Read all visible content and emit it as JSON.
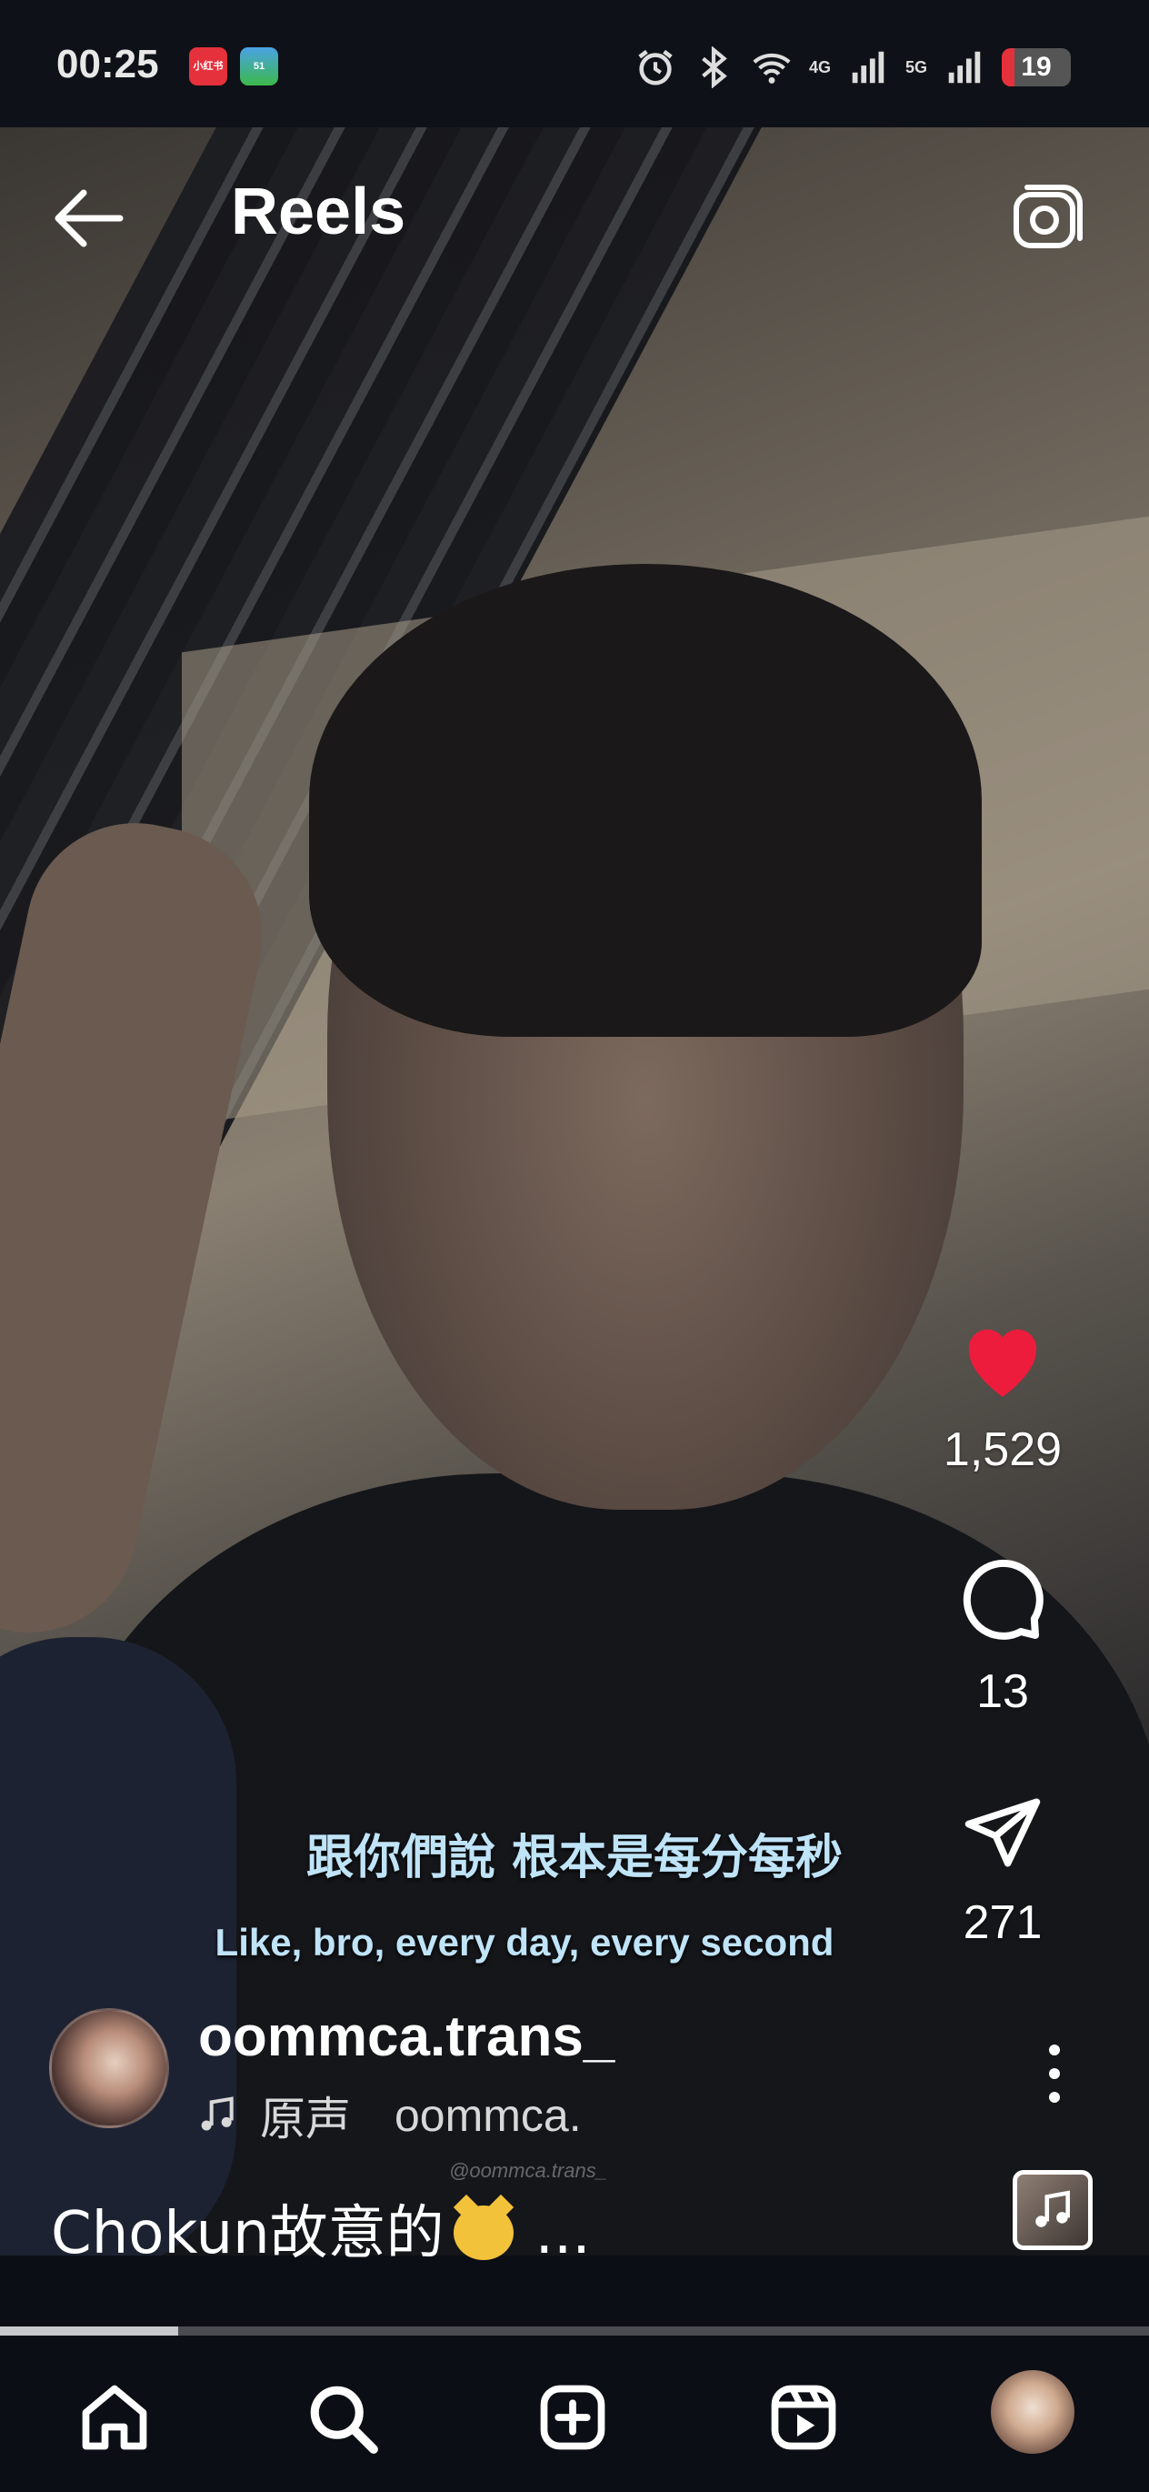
{
  "status_bar": {
    "time": "00:25",
    "app_badges": [
      "小红书",
      "51"
    ],
    "network_4g": "4G",
    "network_5g": "5G",
    "battery": "19",
    "battery_level": 0.19
  },
  "header": {
    "title": "Reels",
    "back_icon": "arrow-left-icon",
    "camera_icon": "camera-icon"
  },
  "video": {
    "subtitle_zh": "跟你們說 根本是每分每秒",
    "subtitle_en": "Like, bro, every day, every second",
    "watermark": "@oommca.trans_"
  },
  "actions": {
    "likes": "1,529",
    "comments": "13",
    "shares": "271",
    "liked": true,
    "like_color": "#ed1c3c"
  },
  "author": {
    "username": "oommca.trans_",
    "audio_label": "原声",
    "audio_artist": "oommca."
  },
  "caption": {
    "text": "Chokun故意的",
    "more": "..."
  },
  "playback": {
    "progress": 0.155
  },
  "nav": {
    "items": [
      "home-icon",
      "search-icon",
      "add-post-icon",
      "reels-icon",
      "profile-avatar"
    ]
  }
}
